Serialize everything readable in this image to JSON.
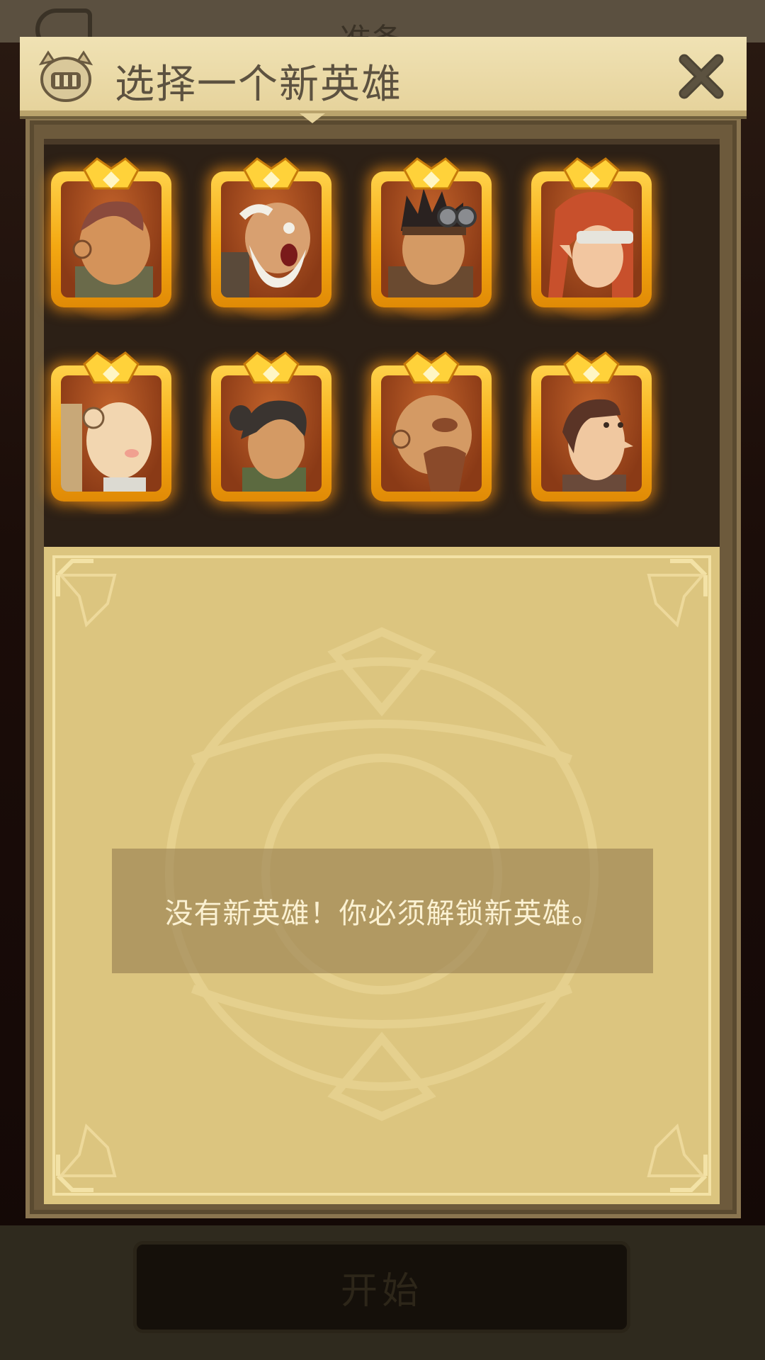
{
  "background": {
    "screen_title": "准备",
    "start_button_label": "开始"
  },
  "dialog": {
    "title": "选择一个新英雄",
    "header_icon": "helmet-icon",
    "close_icon": "close-icon"
  },
  "heroes": [
    {
      "id": "hero-1",
      "icon": "hero-portrait"
    },
    {
      "id": "hero-2",
      "icon": "hero-portrait"
    },
    {
      "id": "hero-3",
      "icon": "hero-portrait"
    },
    {
      "id": "hero-4",
      "icon": "hero-portrait"
    },
    {
      "id": "hero-5",
      "icon": "hero-portrait"
    },
    {
      "id": "hero-6",
      "icon": "hero-portrait"
    },
    {
      "id": "hero-7",
      "icon": "hero-portrait"
    },
    {
      "id": "hero-8",
      "icon": "hero-portrait"
    }
  ],
  "panel": {
    "message": "没有新英雄！你必须解锁新英雄。"
  },
  "colors": {
    "card_gold": "#f4a812",
    "parchment": "#dcc57f",
    "header": "#e6d39c"
  }
}
